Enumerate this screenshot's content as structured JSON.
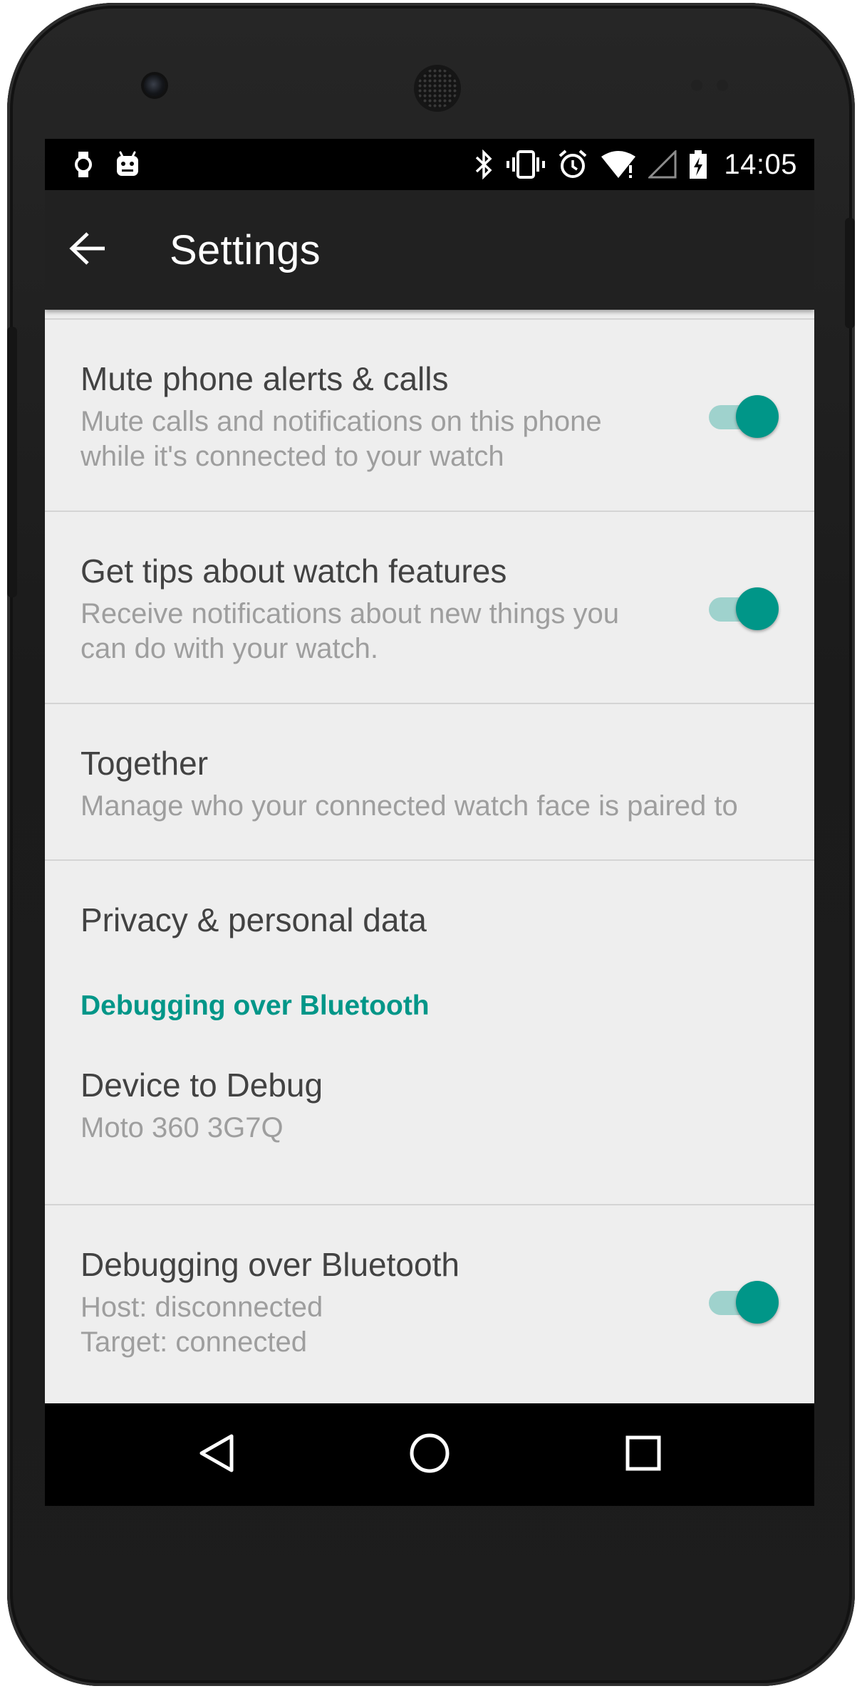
{
  "status_bar": {
    "time": "14:05",
    "left_icons": [
      "watch-icon",
      "android-icon"
    ],
    "right_icons": [
      "bluetooth-icon",
      "vibrate-icon",
      "alarm-icon",
      "wifi-icon",
      "cell-signal-icon",
      "battery-charging-icon"
    ]
  },
  "app_bar": {
    "title": "Settings",
    "back_icon": "arrow-back-icon"
  },
  "settings": {
    "mute": {
      "title": "Mute phone alerts & calls",
      "summary_line1": "Mute calls and notifications on this phone",
      "summary_line2": "while it's connected to your watch",
      "enabled": true
    },
    "tips": {
      "title": "Get tips about watch features",
      "summary_line1": "Receive notifications about new things you",
      "summary_line2": "can do with your watch.",
      "enabled": true
    },
    "together": {
      "title": "Together",
      "summary": "Manage who your connected watch face is paired to"
    },
    "privacy": {
      "title": "Privacy & personal data"
    },
    "debug_category": "Debugging over Bluetooth",
    "device_to_debug": {
      "title": "Device to Debug",
      "summary": "Moto 360 3G7Q"
    },
    "bt_debugging": {
      "title": "Debugging over Bluetooth",
      "summary_line1": "Host: disconnected",
      "summary_line2": "Target: connected",
      "enabled": true
    }
  },
  "nav_bar": {
    "icons": [
      "back-triangle-icon",
      "home-circle-icon",
      "recents-square-icon"
    ]
  },
  "colors": {
    "accent": "#009688",
    "switch_track": "#9fd2cd",
    "app_bar": "#212121",
    "background": "#eeeeee",
    "title_text": "#424242",
    "summary_text": "#9e9e9e"
  }
}
